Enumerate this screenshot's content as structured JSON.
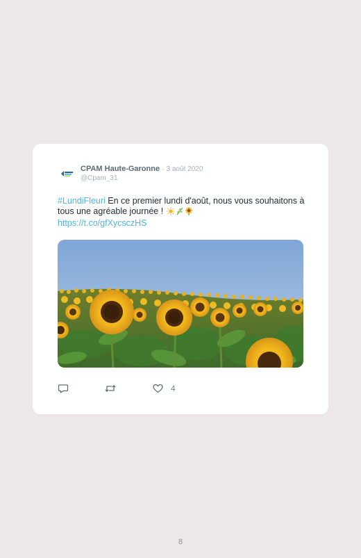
{
  "tweet": {
    "author_name": "CPAM Haute-Garonne",
    "separator": "·",
    "date": "3 août 2020",
    "handle": "@Cpam_31",
    "hashtag": "#LundiFleuri",
    "text": "En ce premier lundi d'août, nous vous souhaitons à tous une agréable journée !",
    "emojis": [
      "sun-emoji",
      "herb-emoji",
      "sunflower-emoji"
    ],
    "link": "https://t.co/gfXycsczHS",
    "likes": "4"
  },
  "page": {
    "number": "8"
  },
  "colors": {
    "background": "#ede7e7",
    "card": "#ffffff",
    "link": "#4fb3e6",
    "muted": "#a5b0bb",
    "name": "#5c6a77"
  }
}
